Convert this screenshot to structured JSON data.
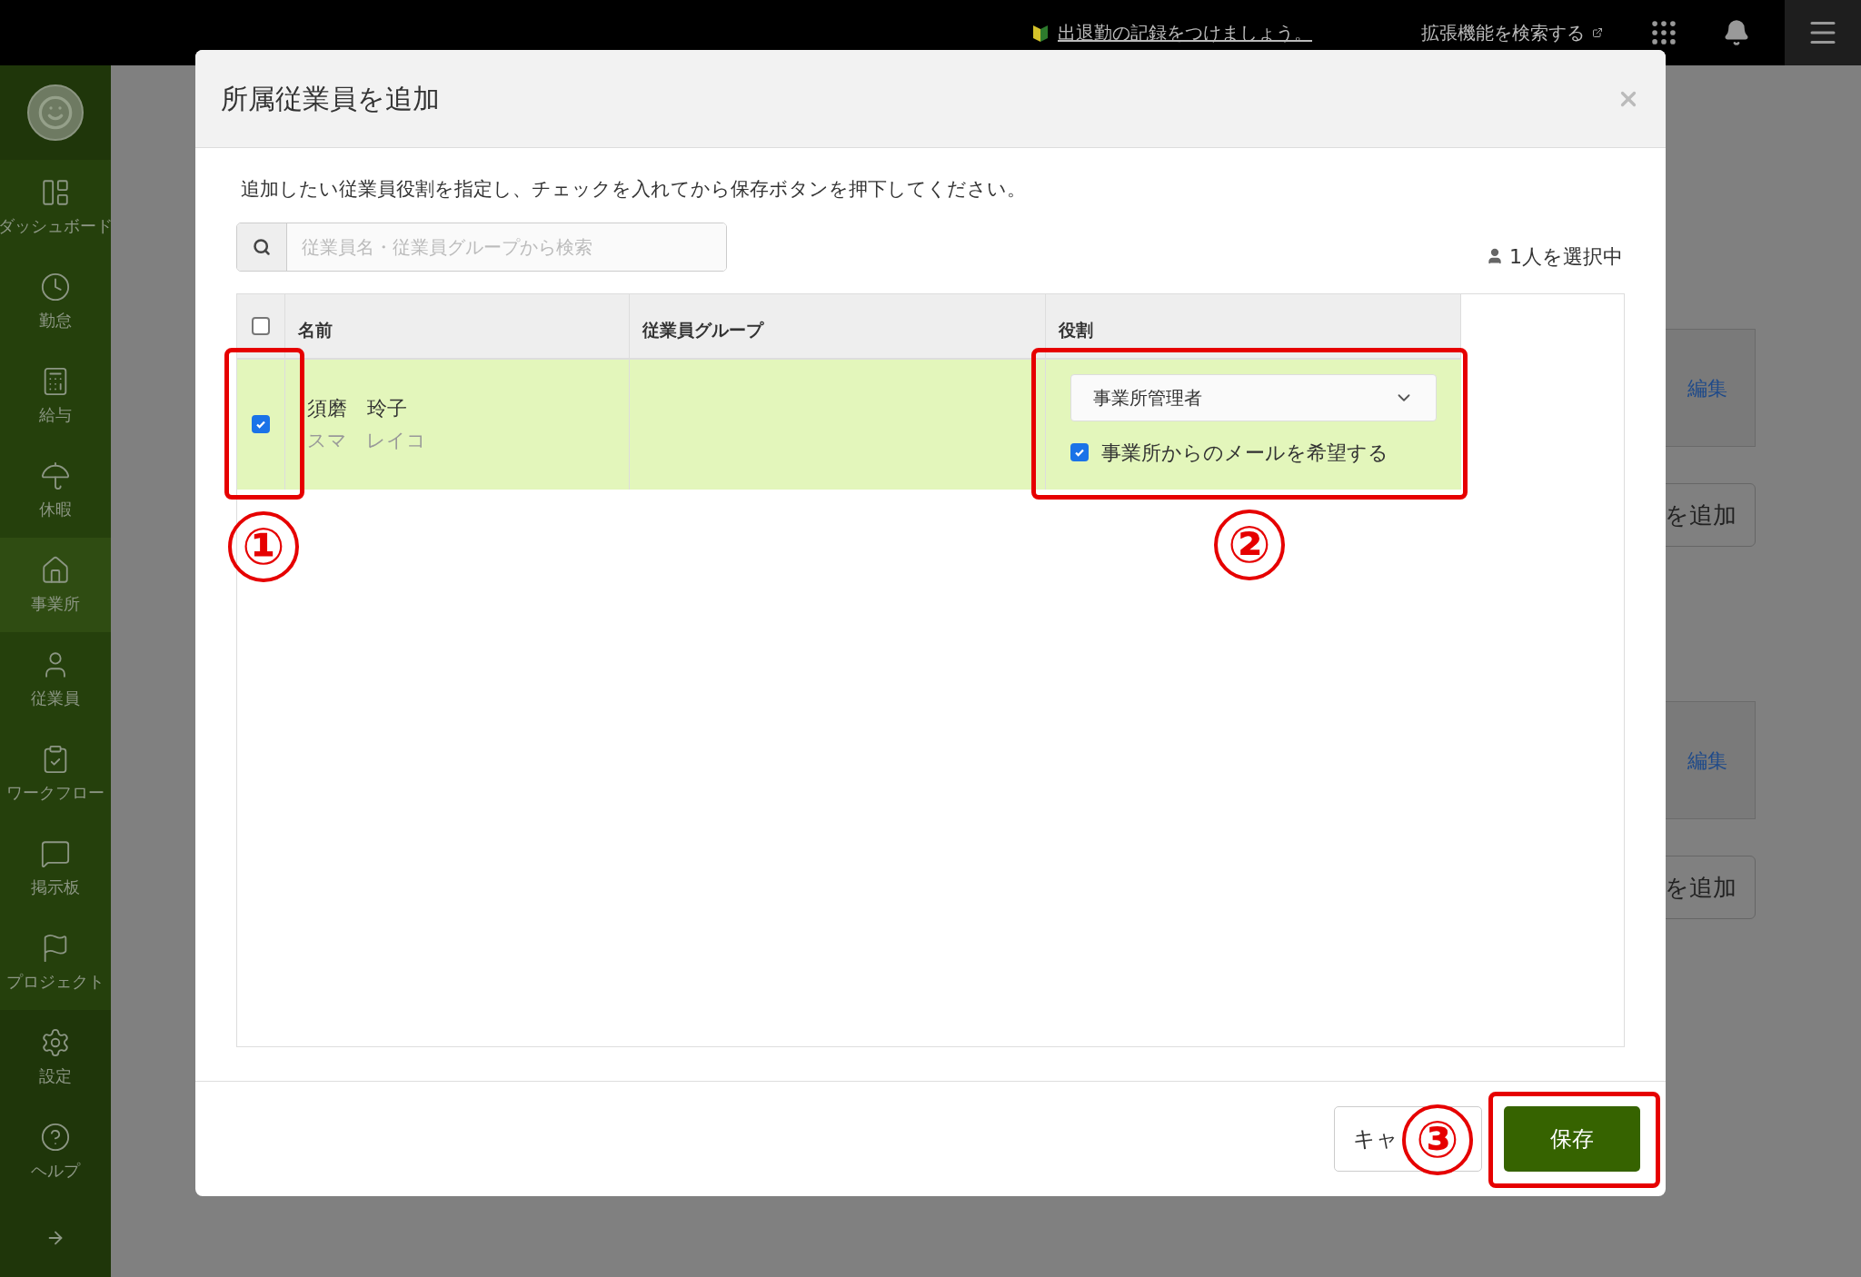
{
  "top_bar": {
    "notice": "出退勤の記録をつけましょう。",
    "extension_link": "拡張機能を検索する"
  },
  "sidebar": {
    "items": [
      {
        "label": "ダッシュボード",
        "selected": false
      },
      {
        "label": "勤怠",
        "selected": false
      },
      {
        "label": "給与",
        "selected": false
      },
      {
        "label": "休暇",
        "selected": false
      },
      {
        "label": "事業所",
        "selected": true
      },
      {
        "label": "従業員",
        "selected": false
      },
      {
        "label": "ワークフロー",
        "selected": false
      },
      {
        "label": "掲示板",
        "selected": false
      },
      {
        "label": "プロジェクト",
        "selected": false
      },
      {
        "label": "設定",
        "selected": false
      },
      {
        "label": "ヘルプ",
        "selected": false
      }
    ]
  },
  "background": {
    "sections": [
      {
        "edit_link": "編集",
        "add_button": "を追加"
      },
      {
        "edit_link": "編集",
        "add_button": "を追加"
      }
    ]
  },
  "dialog": {
    "title": "所属従業員を追加",
    "instruction": "追加したい従業員役割を指定し、チェックを入れてから保存ボタンを押下してください。",
    "search": {
      "placeholder": "従業員名・従業員グループから検索"
    },
    "selection_count": "1人を選択中",
    "table": {
      "select_all_checked": false,
      "columns": [
        "名前",
        "従業員グループ",
        "役割"
      ],
      "rows": [
        {
          "checked": true,
          "name": "須磨　玲子",
          "kana": "スマ　レイコ",
          "group": "",
          "role": "事業所管理者",
          "mail_opt_in": {
            "label": "事業所からのメールを希望する",
            "checked": true
          }
        }
      ]
    },
    "buttons": {
      "cancel": "キャ",
      "save": "保存"
    }
  },
  "annotations": [
    "①",
    "②",
    "③"
  ]
}
